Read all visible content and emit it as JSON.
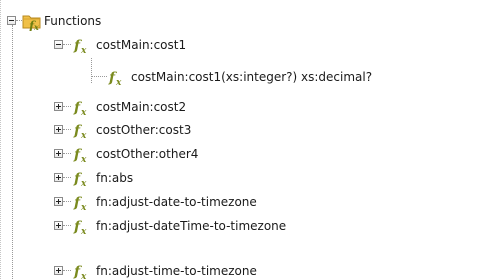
{
  "tree": {
    "root": {
      "label": "Functions",
      "expanded": true,
      "icon": "functions-folder-icon"
    },
    "items": [
      {
        "label": "costMain:cost1",
        "expanded": true,
        "icon": "function-icon"
      },
      {
        "label": "costMain:cost1(xs:integer?) xs:decimal?",
        "leaf": true,
        "icon": "function-icon"
      },
      {
        "label": "costMain:cost2",
        "expanded": false,
        "icon": "function-icon"
      },
      {
        "label": "costOther:cost3",
        "expanded": false,
        "icon": "function-icon"
      },
      {
        "label": "costOther:other4",
        "expanded": false,
        "icon": "function-icon"
      },
      {
        "label": "fn:abs",
        "expanded": false,
        "icon": "function-icon"
      },
      {
        "label": "fn:adjust-date-to-timezone",
        "expanded": false,
        "icon": "function-icon"
      },
      {
        "label": "fn:adjust-dateTime-to-timezone",
        "expanded": false,
        "icon": "function-icon"
      },
      {
        "label": "fn:adjust-time-to-timezone",
        "expanded": false,
        "icon": "function-icon"
      }
    ]
  },
  "colors": {
    "fx_icon": "#7a8a1e",
    "folder_body": "#f0c048",
    "folder_edge": "#b98a1e"
  }
}
